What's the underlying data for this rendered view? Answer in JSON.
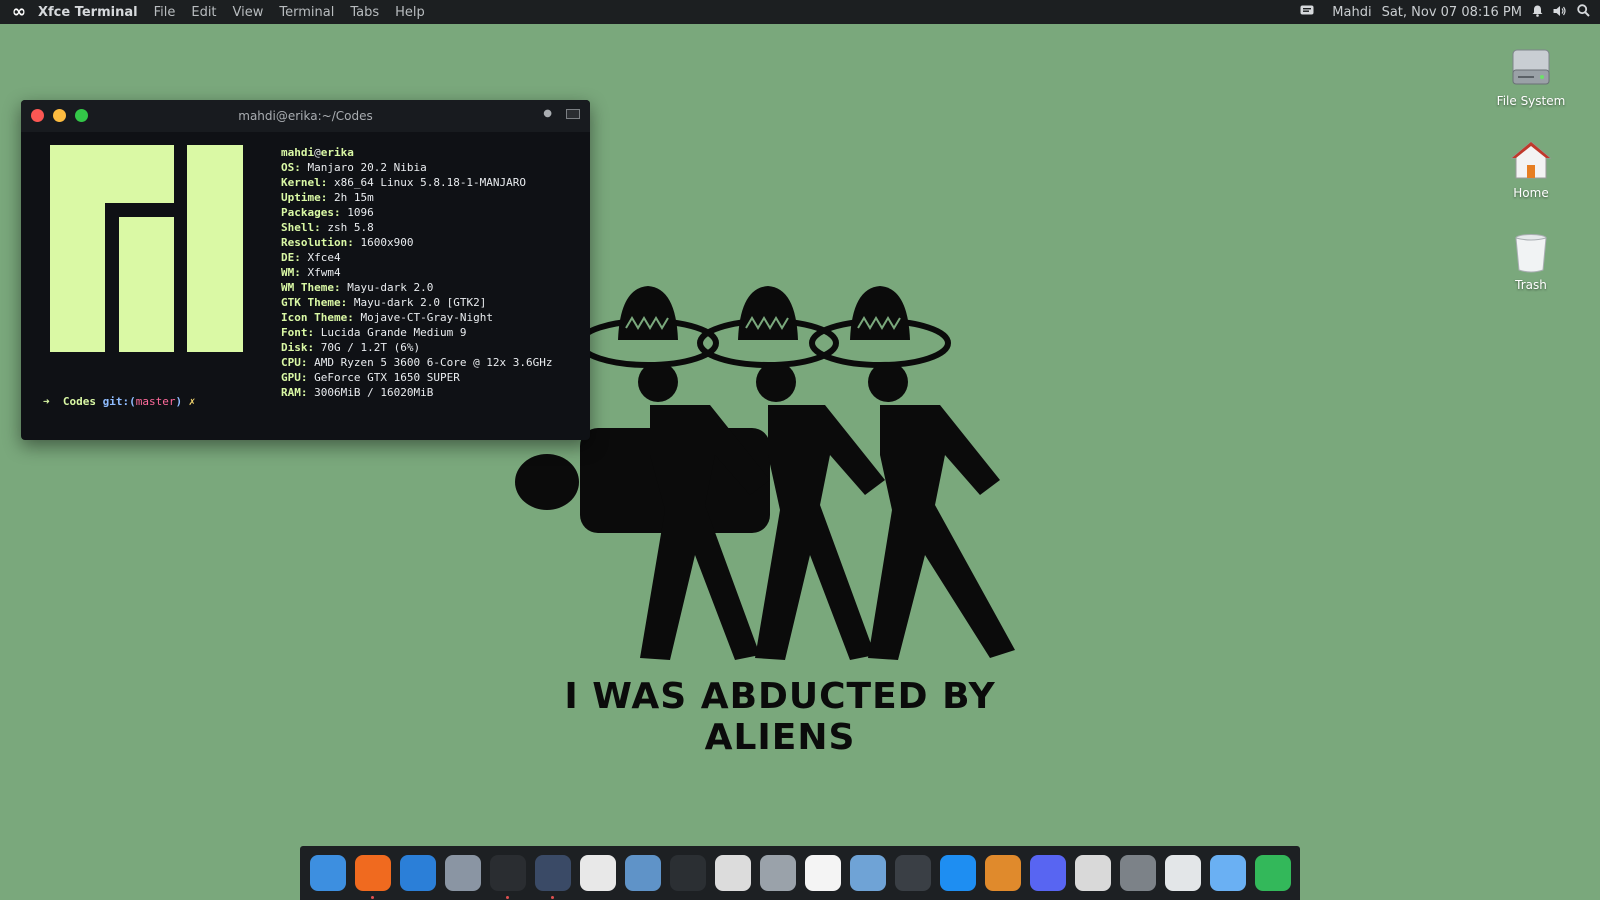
{
  "top_panel": {
    "app_name": "Xfce Terminal",
    "menu": [
      "File",
      "Edit",
      "View",
      "Terminal",
      "Tabs",
      "Help"
    ],
    "user": "Mahdi",
    "datetime": "Sat, Nov 07 08:16 PM"
  },
  "desktop_icons": [
    {
      "label": "File System",
      "icon": "drive-icon"
    },
    {
      "label": "Home",
      "icon": "home-icon"
    },
    {
      "label": "Trash",
      "icon": "trash-icon"
    }
  ],
  "terminal": {
    "title": "mahdi@erika:~/Codes",
    "user": "mahdi",
    "host": "erika",
    "info": [
      {
        "key": "OS:",
        "value": "Manjaro 20.2 Nibia"
      },
      {
        "key": "Kernel:",
        "value": "x86_64 Linux 5.8.18-1-MANJARO"
      },
      {
        "key": "Uptime:",
        "value": "2h 15m"
      },
      {
        "key": "Packages:",
        "value": "1096"
      },
      {
        "key": "Shell:",
        "value": "zsh 5.8"
      },
      {
        "key": "Resolution:",
        "value": "1600x900"
      },
      {
        "key": "DE:",
        "value": "Xfce4"
      },
      {
        "key": "WM:",
        "value": "Xfwm4"
      },
      {
        "key": "WM Theme:",
        "value": "Mayu-dark 2.0"
      },
      {
        "key": "GTK Theme:",
        "value": "Mayu-dark 2.0 [GTK2]"
      },
      {
        "key": "Icon Theme:",
        "value": "Mojave-CT-Gray-Night"
      },
      {
        "key": "Font:",
        "value": "Lucida Grande Medium 9"
      },
      {
        "key": "Disk:",
        "value": "70G / 1.2T (6%)"
      },
      {
        "key": "CPU:",
        "value": "AMD Ryzen 5 3600 6-Core @ 12x 3.6GHz"
      },
      {
        "key": "GPU:",
        "value": "GeForce GTX 1650 SUPER"
      },
      {
        "key": "RAM:",
        "value": "3006MiB / 16020MiB"
      }
    ],
    "prompt": {
      "arrow": "➜",
      "dir": "Codes",
      "git_label": "git:(",
      "branch": "master",
      "git_close": ")",
      "dirty": "✗"
    },
    "logo_color": "#daf9a5"
  },
  "wallpaper": {
    "caption": "I WAS ABDUCTED BY ALIENS"
  },
  "dock": [
    {
      "name": "finder-icon",
      "color": "#3d8fe0",
      "running": false
    },
    {
      "name": "firefox-icon",
      "color": "#f06a1f",
      "running": true
    },
    {
      "name": "safari-icon",
      "color": "#2b7fd8",
      "running": false
    },
    {
      "name": "launchpad-rocket-icon",
      "color": "#8a95a3",
      "running": false
    },
    {
      "name": "terminal-icon",
      "color": "#2a2d31",
      "running": true
    },
    {
      "name": "vscode-icon",
      "color": "#3a4a66",
      "running": true
    },
    {
      "name": "text-editor-icon",
      "color": "#e8e8e8",
      "running": false
    },
    {
      "name": "preview-icon",
      "color": "#5f93c8",
      "running": false
    },
    {
      "name": "notes-check-icon",
      "color": "#2b2f33",
      "running": false
    },
    {
      "name": "screenshot-icon",
      "color": "#dcdcdc",
      "running": false
    },
    {
      "name": "photo-booth-icon",
      "color": "#9aa2aa",
      "running": false
    },
    {
      "name": "calendar-icon",
      "color": "#f4f4f4",
      "running": false
    },
    {
      "name": "image-viewer-icon",
      "color": "#6fa3d6",
      "running": false
    },
    {
      "name": "utilities-icon",
      "color": "#3a3f45",
      "running": false
    },
    {
      "name": "app-store-icon",
      "color": "#1e8ef2",
      "running": false
    },
    {
      "name": "media-player-icon",
      "color": "#e08a2c",
      "running": false
    },
    {
      "name": "discord-icon",
      "color": "#5865f2",
      "running": false
    },
    {
      "name": "system-monitor-icon",
      "color": "#d9d9d9",
      "running": false
    },
    {
      "name": "settings-gear-icon",
      "color": "#7c8288",
      "running": false
    },
    {
      "name": "trash-icon",
      "color": "#e3e6e8",
      "running": false
    },
    {
      "name": "files-folder-icon",
      "color": "#6ab0f3",
      "running": false
    },
    {
      "name": "package-cube-icon",
      "color": "#33b85a",
      "running": false
    }
  ]
}
